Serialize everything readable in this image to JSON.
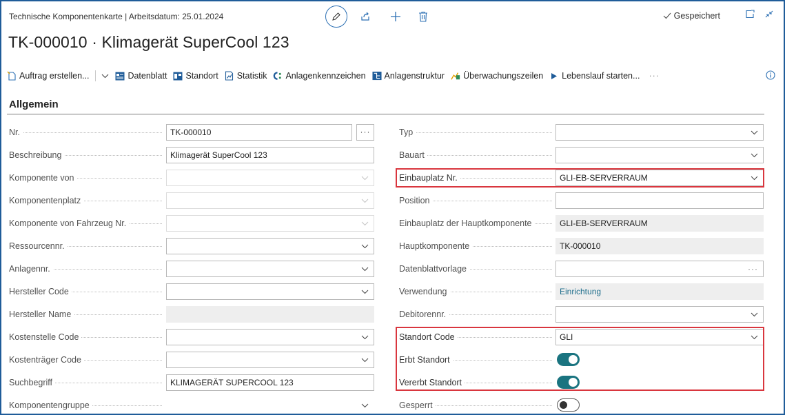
{
  "header": {
    "caption": "Technische Komponentenkarte | Arbeitsdatum: 25.01.2024",
    "status": "Gespeichert",
    "title": "TK-000010 · Klimagerät SuperCool 123"
  },
  "actions": [
    {
      "label": "Auftrag erstellen...",
      "icon": "new-order-icon"
    },
    {
      "label": "Datenblatt",
      "icon": "datasheet-icon"
    },
    {
      "label": "Standort",
      "icon": "location-icon"
    },
    {
      "label": "Statistik",
      "icon": "statistics-icon"
    },
    {
      "label": "Anlagenkennzeichen",
      "icon": "asset-tag-icon"
    },
    {
      "label": "Anlagenstruktur",
      "icon": "structure-icon"
    },
    {
      "label": "Überwachungszeilen",
      "icon": "monitoring-icon"
    },
    {
      "label": "Lebenslauf starten...",
      "icon": "play-icon"
    }
  ],
  "section": {
    "title": "Allgemein"
  },
  "left_fields": [
    {
      "label": "Nr.",
      "value": "TK-000010"
    },
    {
      "label": "Beschreibung",
      "value": "Klimagerät SuperCool 123"
    },
    {
      "label": "Komponente von",
      "value": ""
    },
    {
      "label": "Komponentenplatz",
      "value": ""
    },
    {
      "label": "Komponente von Fahrzeug Nr.",
      "value": ""
    },
    {
      "label": "Ressourcennr.",
      "value": ""
    },
    {
      "label": "Anlagennr.",
      "value": ""
    },
    {
      "label": "Hersteller Code",
      "value": ""
    },
    {
      "label": "Hersteller Name",
      "value": ""
    },
    {
      "label": "Kostenstelle Code",
      "value": ""
    },
    {
      "label": "Kostenträger Code",
      "value": ""
    },
    {
      "label": "Suchbegriff",
      "value": "KLIMAGERÄT SUPERCOOL 123"
    },
    {
      "label": "Komponentengruppe",
      "value": ""
    }
  ],
  "right_fields": [
    {
      "label": "Typ",
      "value": ""
    },
    {
      "label": "Bauart",
      "value": ""
    },
    {
      "label": "Einbauplatz Nr.",
      "value": "GLI-EB-SERVERRAUM"
    },
    {
      "label": "Position",
      "value": ""
    },
    {
      "label": "Einbauplatz der Hauptkomponente",
      "value": "GLI-EB-SERVERRAUM"
    },
    {
      "label": "Hauptkomponente",
      "value": "TK-000010"
    },
    {
      "label": "Datenblattvorlage",
      "value": ""
    },
    {
      "label": "Verwendung",
      "value": "Einrichtung"
    },
    {
      "label": "Debitorennr.",
      "value": ""
    },
    {
      "label": "Standort Code",
      "value": "GLI"
    },
    {
      "label": "Erbt Standort",
      "value": true
    },
    {
      "label": "Vererbt Standort",
      "value": true
    },
    {
      "label": "Gesperrt",
      "value": false
    }
  ]
}
